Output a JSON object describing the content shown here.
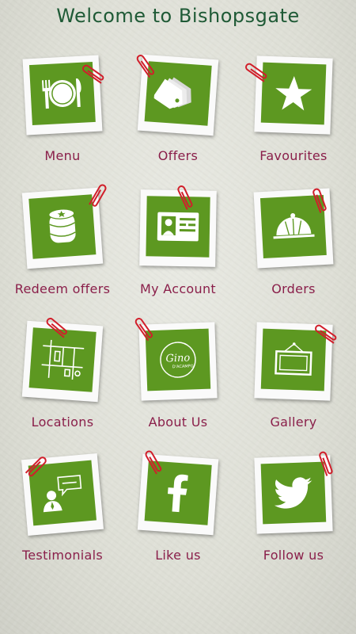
{
  "header": {
    "title": "Welcome to Bishopsgate"
  },
  "colors": {
    "accent": "#5d9821",
    "label": "#8a1f4a",
    "title": "#1f5a36",
    "clip": "#d11e2a"
  },
  "tiles": [
    {
      "label": "Menu",
      "icon": "cutlery-plate-icon"
    },
    {
      "label": "Offers",
      "icon": "tags-icon"
    },
    {
      "label": "Favourites",
      "icon": "star-icon"
    },
    {
      "label": "Redeem offers",
      "icon": "coin-stack-icon"
    },
    {
      "label": "My Account",
      "icon": "id-card-icon"
    },
    {
      "label": "Orders",
      "icon": "cloche-icon"
    },
    {
      "label": "Locations",
      "icon": "map-icon"
    },
    {
      "label": "About Us",
      "icon": "gino-dacampo-logo-icon"
    },
    {
      "label": "Gallery",
      "icon": "picture-frame-icon"
    },
    {
      "label": "Testimonials",
      "icon": "speech-bubble-icon"
    },
    {
      "label": "Like us",
      "icon": "facebook-icon"
    },
    {
      "label": "Follow us",
      "icon": "twitter-icon"
    }
  ],
  "logo_text": {
    "line1": "Gino",
    "line2": "D'ACAMPO"
  }
}
